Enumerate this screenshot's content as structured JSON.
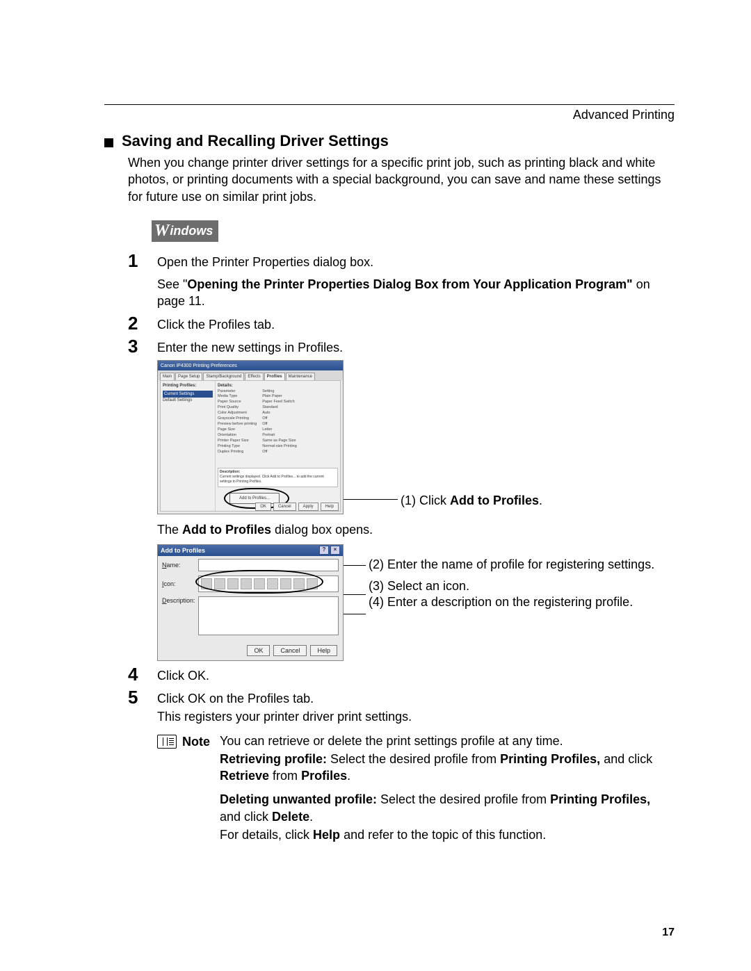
{
  "chapter": "Advanced Printing",
  "section_title": "Saving and Recalling Driver Settings",
  "intro": "When you change printer driver settings for a specific print job, such as printing black and white photos, or printing documents with a special background, you can save and name these settings for future use on similar print jobs.",
  "os_badge": "indows",
  "steps": {
    "s1": {
      "num": "1",
      "lead": "Open the Printer Properties dialog box.",
      "sub_prefix": "See \"",
      "sub_bold": "Opening the Printer Properties Dialog Box from Your Application Program\"",
      "sub_suffix": " on page 11."
    },
    "s2": {
      "num": "2",
      "lead": "Click the Profiles tab."
    },
    "s3": {
      "num": "3",
      "lead": "Enter the new settings in Profiles."
    },
    "s4": {
      "num": "4",
      "lead": "Click OK."
    },
    "s5": {
      "num": "5",
      "lead": "Click OK on the Profiles tab.",
      "sub": "This registers your printer driver print settings."
    }
  },
  "shot1": {
    "title": "Canon iP4300 Printing Preferences",
    "tabs": [
      "Main",
      "Page Setup",
      "Stamp/Background",
      "Effects",
      "Profiles",
      "Maintenance"
    ],
    "active_tab": "Profiles",
    "left_header": "Printing Profiles:",
    "left_items": [
      "Current Settings",
      "Default Settings"
    ],
    "detail_header": "Details:",
    "params": [
      "Parameter",
      "Media Type",
      "Paper Source",
      "Print Quality",
      "Color Adjustment",
      "Grayscale Printing",
      "Preview before printing",
      "Page Size",
      "Orientation",
      "Printer Paper Size",
      "Printing Type",
      "Duplex Printing"
    ],
    "values": [
      "Setting",
      "Plain Paper",
      "Paper Feed Switch",
      "Standard",
      "Auto",
      "Off",
      "Off",
      "Letter",
      "Portrait",
      "Same as Page Size",
      "Normal-size Printing",
      "Off"
    ],
    "desc_label": "Description:",
    "desc_text": "Current settings displayed. Click Add to Profiles... to add the current settings to Printing Profiles.",
    "add_btn": "Add to Profiles...",
    "buttons": [
      "OK",
      "Cancel",
      "Apply",
      "Help"
    ]
  },
  "callout1_prefix": "(1)  Click ",
  "callout1_bold": "Add to Profiles",
  "callout1_suffix": ".",
  "after_shot1_prefix": "The ",
  "after_shot1_bold": "Add to Profiles",
  "after_shot1_suffix": " dialog box opens.",
  "shot2": {
    "title": "Add to Profiles",
    "name_label": "Name:",
    "icon_label": "Icon:",
    "desc_label": "Description:",
    "buttons": {
      "ok": "OK",
      "cancel": "Cancel",
      "help": "Help"
    }
  },
  "callouts2": {
    "c2": "(2)  Enter the name of profile for registering settings.",
    "c3": "(3)  Select an icon.",
    "c4": "(4)  Enter a description on the registering profile."
  },
  "note": {
    "label": "Note",
    "p1": "You can retrieve or delete the print settings profile at any time.",
    "p2a": "Retrieving profile: ",
    "p2b": "Select the desired profile from ",
    "p2c": "Printing Profiles,",
    "p2d": " and click ",
    "p2e": "Retrieve",
    "p2f": " from ",
    "p2g": "Profiles",
    "p2h": ".",
    "p3a": "Deleting unwanted profile: ",
    "p3b": "Select the desired profile from ",
    "p3c": "Printing Profiles,",
    "p3d": " and click ",
    "p3e": "Delete",
    "p3f": ".",
    "p4a": "For details, click ",
    "p4b": "Help",
    "p4c": " and refer to the topic of this function."
  },
  "page_number": "17"
}
